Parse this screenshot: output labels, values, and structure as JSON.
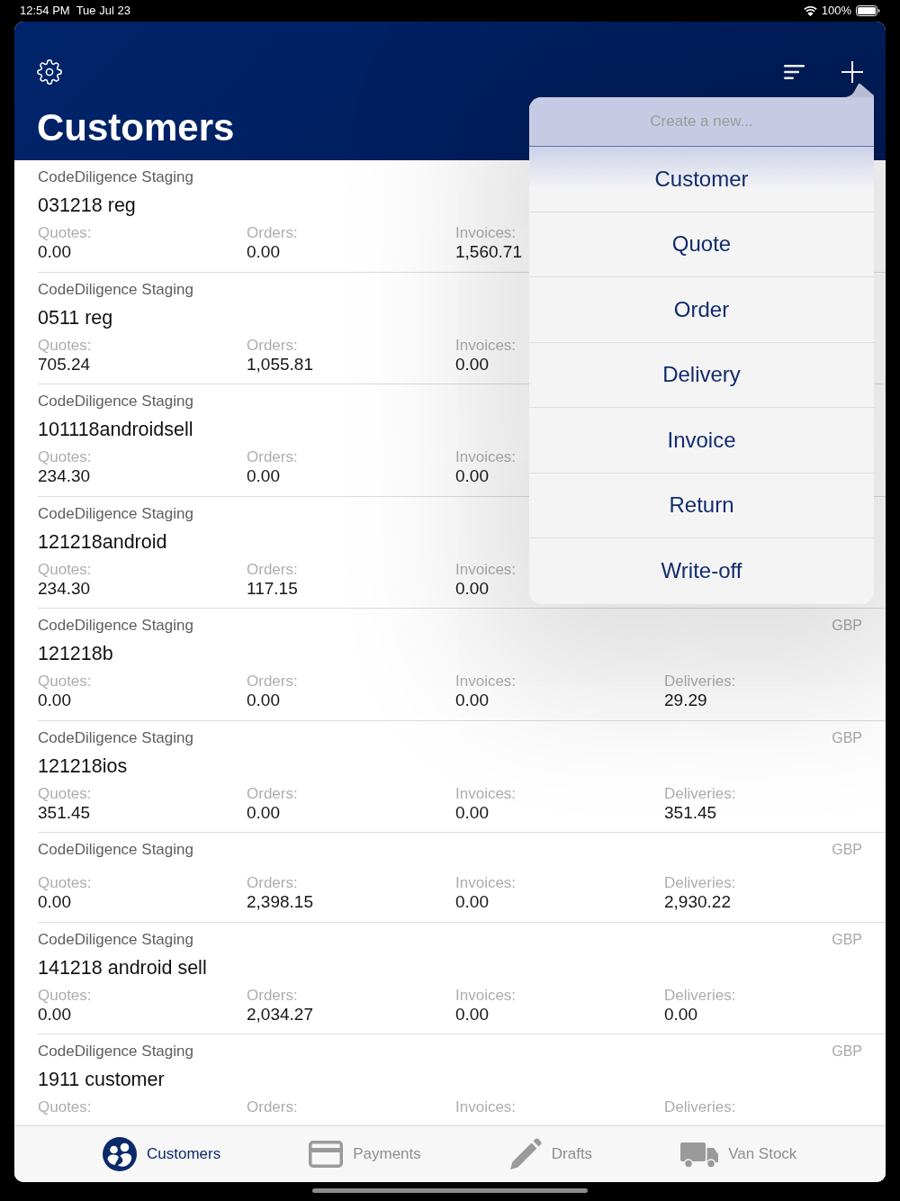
{
  "status_bar": {
    "time": "12:54 PM",
    "date": "Tue Jul 23",
    "battery": "100%"
  },
  "header": {
    "title": "Customers"
  },
  "customers": [
    {
      "company": "CodeDiligence Staging",
      "name": "031218 reg",
      "stats": [
        {
          "label": "Quotes:",
          "value": "0.00"
        },
        {
          "label": "Orders:",
          "value": "0.00"
        },
        {
          "label": "Invoices:",
          "value": "1,560.71"
        }
      ]
    },
    {
      "company": "CodeDiligence Staging",
      "name": "0511 reg",
      "stats": [
        {
          "label": "Quotes:",
          "value": "705.24"
        },
        {
          "label": "Orders:",
          "value": "1,055.81"
        },
        {
          "label": "Invoices:",
          "value": "0.00"
        }
      ]
    },
    {
      "company": "CodeDiligence Staging",
      "name": "101118androidsell",
      "stats": [
        {
          "label": "Quotes:",
          "value": "234.30"
        },
        {
          "label": "Orders:",
          "value": "0.00"
        },
        {
          "label": "Invoices:",
          "value": "0.00"
        }
      ]
    },
    {
      "company": "CodeDiligence Staging",
      "name": "121218android",
      "stats": [
        {
          "label": "Quotes:",
          "value": "234.30"
        },
        {
          "label": "Orders:",
          "value": "117.15"
        },
        {
          "label": "Invoices:",
          "value": "0.00"
        }
      ]
    },
    {
      "company": "CodeDiligence Staging",
      "name": "121218b",
      "currency": "GBP",
      "stats": [
        {
          "label": "Quotes:",
          "value": "0.00"
        },
        {
          "label": "Orders:",
          "value": "0.00"
        },
        {
          "label": "Invoices:",
          "value": "0.00"
        },
        {
          "label": "Deliveries:",
          "value": "29.29"
        }
      ]
    },
    {
      "company": "CodeDiligence Staging",
      "name": "121218ios",
      "currency": "GBP",
      "stats": [
        {
          "label": "Quotes:",
          "value": "351.45"
        },
        {
          "label": "Orders:",
          "value": "0.00"
        },
        {
          "label": "Invoices:",
          "value": "0.00"
        },
        {
          "label": "Deliveries:",
          "value": "351.45"
        }
      ]
    },
    {
      "company": "CodeDiligence Staging",
      "currency": "GBP",
      "stats": [
        {
          "label": "Quotes:",
          "value": "0.00"
        },
        {
          "label": "Orders:",
          "value": "2,398.15"
        },
        {
          "label": "Invoices:",
          "value": "0.00"
        },
        {
          "label": "Deliveries:",
          "value": "2,930.22"
        }
      ]
    },
    {
      "company": "CodeDiligence Staging",
      "name": "141218 android sell",
      "currency": "GBP",
      "stats": [
        {
          "label": "Quotes:",
          "value": "0.00"
        },
        {
          "label": "Orders:",
          "value": "2,034.27"
        },
        {
          "label": "Invoices:",
          "value": "0.00"
        },
        {
          "label": "Deliveries:",
          "value": "0.00"
        }
      ]
    },
    {
      "company": "CodeDiligence Staging",
      "name": "1911 customer",
      "currency": "GBP",
      "stats": [
        {
          "label": "Quotes:"
        },
        {
          "label": "Orders:"
        },
        {
          "label": "Invoices:"
        },
        {
          "label": "Deliveries:"
        }
      ]
    }
  ],
  "popover": {
    "title": "Create a new...",
    "items": [
      "Customer",
      "Quote",
      "Order",
      "Delivery",
      "Invoice",
      "Return",
      "Write-off"
    ]
  },
  "tabs": [
    {
      "label": "Customers",
      "selected": true
    },
    {
      "label": "Payments",
      "selected": false
    },
    {
      "label": "Drafts",
      "selected": false
    },
    {
      "label": "Van Stock",
      "selected": false
    }
  ]
}
